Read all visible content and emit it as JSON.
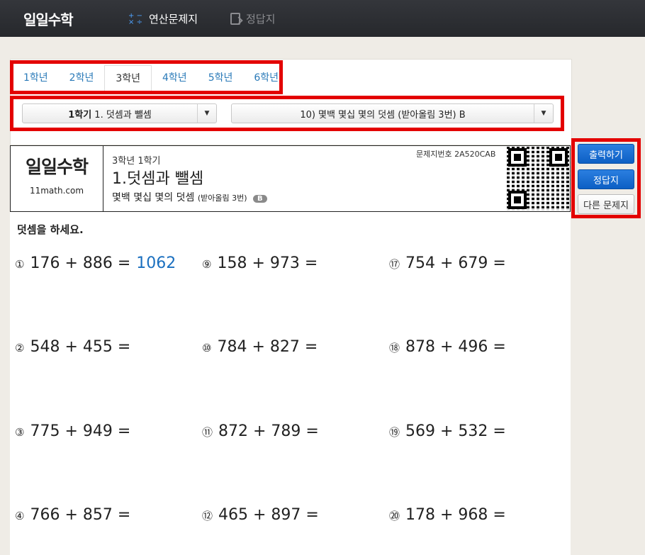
{
  "nav": {
    "logo": "일일수학",
    "practice_label": "연산문제지",
    "answer_label": "정답지"
  },
  "grades": [
    "1학년",
    "2학년",
    "3학년",
    "4학년",
    "5학년",
    "6학년"
  ],
  "active_grade": "3학년",
  "selects": {
    "semester_bold": "1학기",
    "semester_rest": " 1. 덧셈과 뺄셈",
    "worksheet": "10) 몇백 몇십 몇의 덧셈 (받아올림 3번) B"
  },
  "sheet": {
    "brand_logo": "일일수학",
    "brand_url": "11math.com",
    "grade_semester": "3학년 1학기",
    "unit_title": "1.덧셈과 뺄셈",
    "subtitle": "몇백 몇십 몇의 덧셈",
    "subtitle_small": "(받아올림 3번)",
    "level_badge": "B",
    "code": "문제지번호 2A520CAB",
    "instruction": "덧셈을 하세요."
  },
  "problems": [
    {
      "num": "①",
      "expr": "176 + 886 =",
      "answer": "1062"
    },
    {
      "num": "②",
      "expr": "548 + 455 =",
      "answer": ""
    },
    {
      "num": "③",
      "expr": "775 + 949 =",
      "answer": ""
    },
    {
      "num": "④",
      "expr": "766 + 857 =",
      "answer": ""
    },
    {
      "num": "⑨",
      "expr": "158 + 973 =",
      "answer": ""
    },
    {
      "num": "⑩",
      "expr": "784 + 827 =",
      "answer": ""
    },
    {
      "num": "⑪",
      "expr": "872 + 789 =",
      "answer": ""
    },
    {
      "num": "⑫",
      "expr": "465 + 897 =",
      "answer": ""
    },
    {
      "num": "⑰",
      "expr": "754 + 679 =",
      "answer": ""
    },
    {
      "num": "⑱",
      "expr": "878 + 496 =",
      "answer": ""
    },
    {
      "num": "⑲",
      "expr": "569 + 532 =",
      "answer": ""
    },
    {
      "num": "⑳",
      "expr": "178 + 968 =",
      "answer": ""
    }
  ],
  "actions": {
    "print": "출력하기",
    "answers": "정답지",
    "other": "다른 문제지"
  },
  "colors": {
    "highlight": "#e30000",
    "link": "#2a7ab8",
    "answer": "#1a6fbf",
    "button": "#0d5fc4"
  }
}
